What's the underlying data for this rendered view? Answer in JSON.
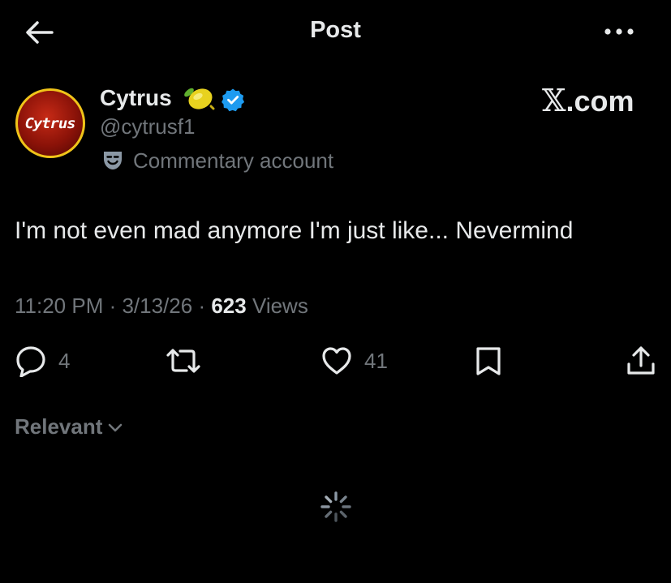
{
  "header": {
    "title": "Post"
  },
  "author": {
    "display_name": "Cytrus",
    "handle": "@cytrusf1",
    "avatar_text": "Cytrus",
    "label": "Commentary account",
    "verified": true,
    "accent_color": "#1d9bf0"
  },
  "watermark": {
    "x": "𝕏",
    "domain": ".com"
  },
  "post": {
    "text": "I'm not even mad anymore I'm just like... Nevermind"
  },
  "meta": {
    "time": "11:20 PM",
    "separator": " · ",
    "date": "3/13/26",
    "views_count": "623",
    "views_label": " Views"
  },
  "actions": {
    "replies": "4",
    "likes": "41"
  },
  "replies_sort": {
    "label": "Relevant"
  },
  "icons": [
    "back-arrow-icon",
    "more-icon",
    "lemon-icon",
    "verified-badge-icon",
    "theater-masks-icon",
    "reply-icon",
    "retweet-icon",
    "like-icon",
    "bookmark-icon",
    "share-icon",
    "chevron-down-icon",
    "loading-spinner-icon"
  ]
}
